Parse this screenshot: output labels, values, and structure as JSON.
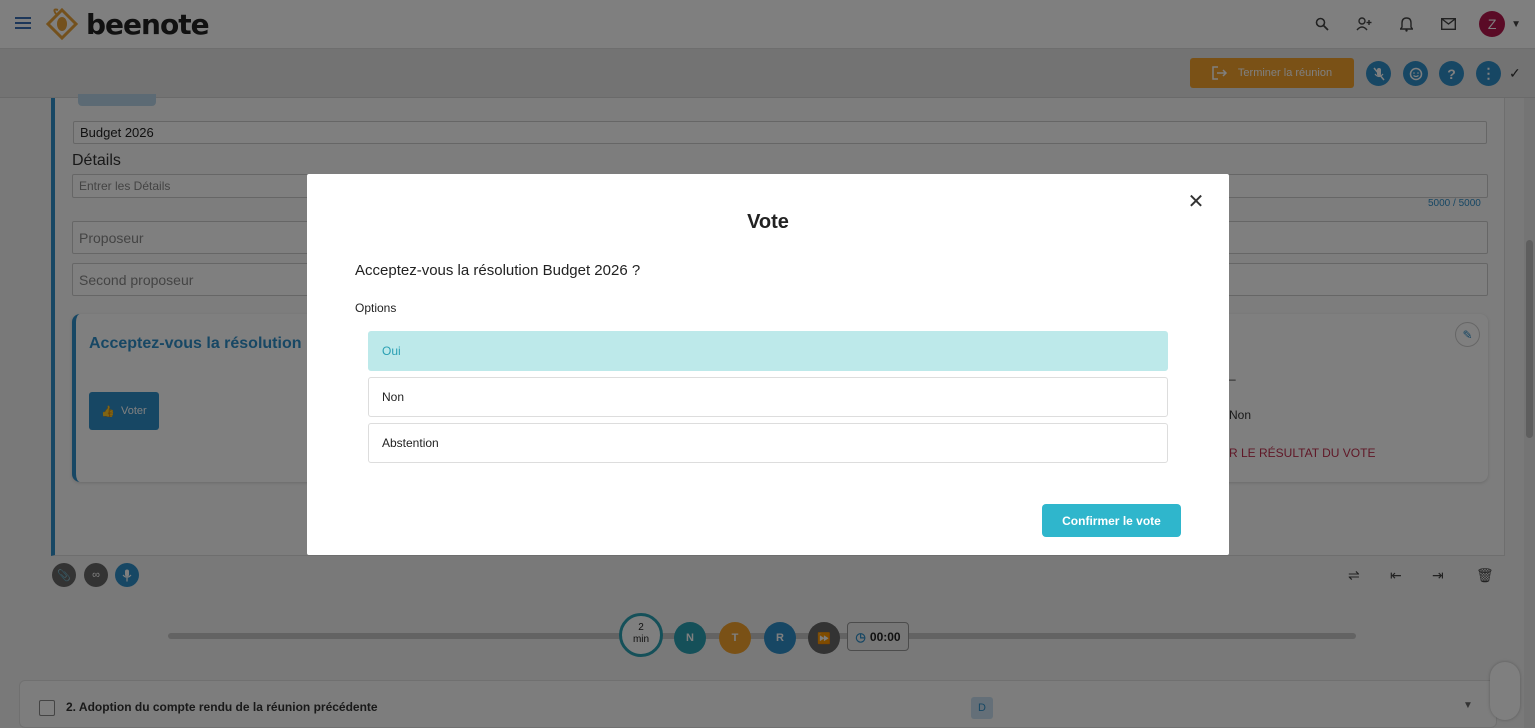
{
  "header": {
    "brand": "beenote",
    "avatar_initial": "Z"
  },
  "toolbar": {
    "end_meeting_label": "Terminer la réunion"
  },
  "resolution": {
    "title_value": "Budget 2026",
    "details_label": "Détails",
    "details_placeholder": "Entrer les Détails",
    "char_counter": "5000 / 5000",
    "proposer_placeholder": "Proposeur",
    "second_proposer_placeholder": "Second proposeur",
    "vote_card_title": "Acceptez-vous la résolution B",
    "vote_button_label": "Voter",
    "bg_option_non": "Non",
    "bg_result_link": "R LE RÉSULTAT DU VOTE"
  },
  "timeline": {
    "timer_value": "2",
    "timer_unit": "min",
    "btn_n": "N",
    "btn_t": "T",
    "btn_r": "R",
    "clock": "00:00"
  },
  "agenda": {
    "item_number": "2.",
    "item_title": "Adoption du compte rendu de la réunion précédente",
    "badge": "D"
  },
  "modal": {
    "title": "Vote",
    "question": "Acceptez-vous la résolution Budget 2026 ?",
    "options_label": "Options",
    "options": [
      "Oui",
      "Non",
      "Abstention"
    ],
    "selected_option": "Oui",
    "confirm_label": "Confirmer le vote"
  },
  "colors": {
    "primary": "#2f8fc9",
    "accent_orange": "#f4a32c",
    "teal": "#2fb6cc",
    "selected_bg": "#bde9ea",
    "danger": "#c0304f"
  }
}
